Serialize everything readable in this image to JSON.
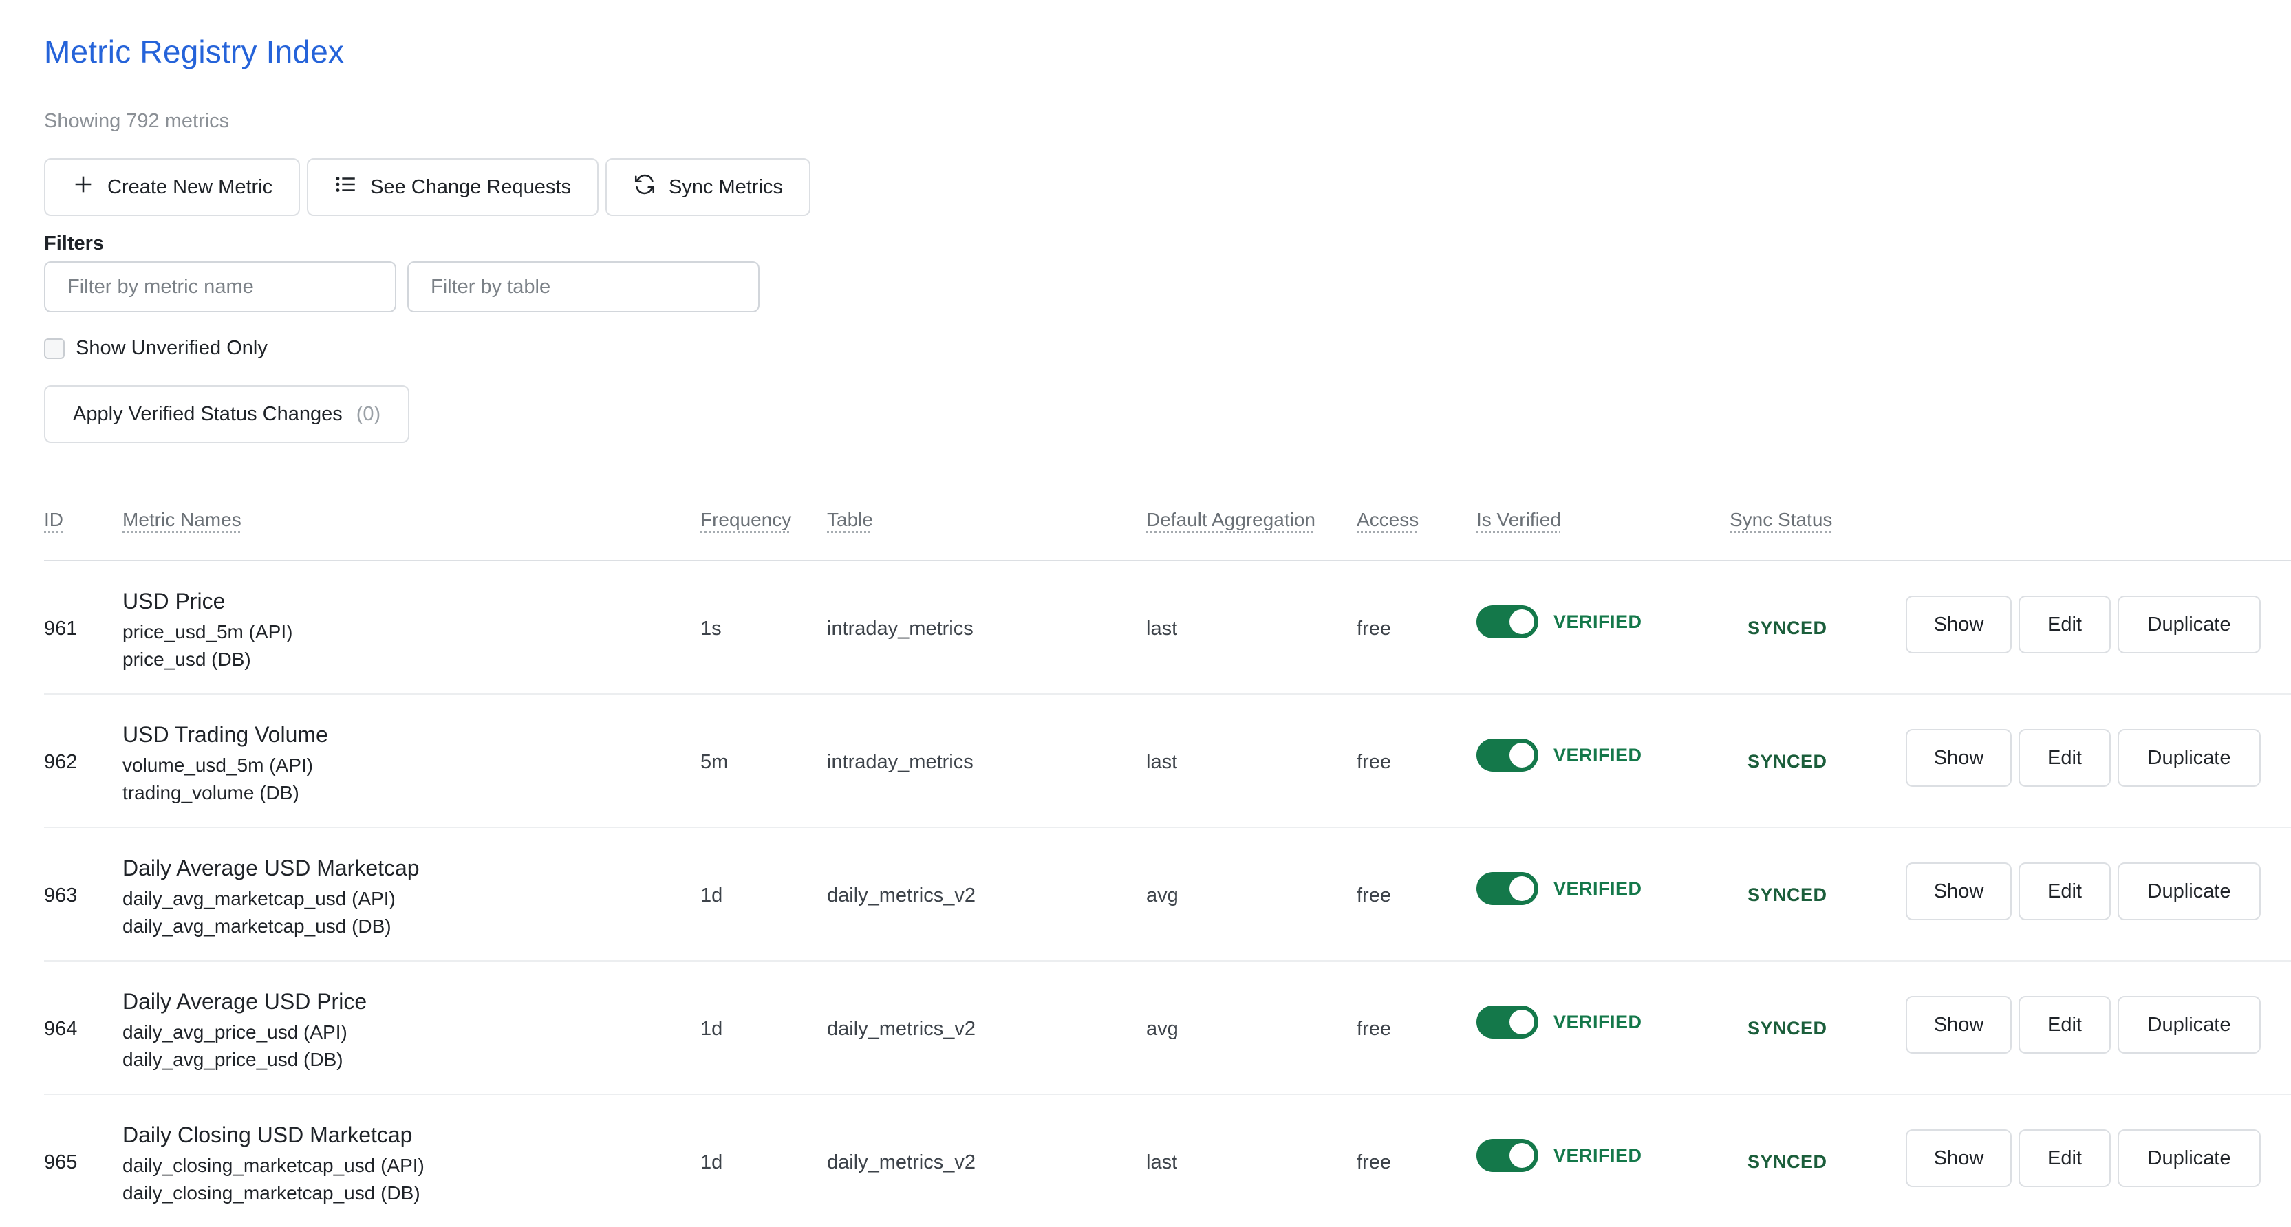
{
  "page": {
    "title": "Metric Registry Index",
    "count_text": "Showing 792 metrics"
  },
  "actions": {
    "create": "Create New Metric",
    "change_requests": "See Change Requests",
    "sync": "Sync Metrics"
  },
  "filters": {
    "label": "Filters",
    "metric_placeholder": "Filter by metric name",
    "table_placeholder": "Filter by table",
    "unverified_label": "Show Unverified Only",
    "unverified_checked": false,
    "apply_label": "Apply Verified Status Changes",
    "apply_count": "(0)"
  },
  "table": {
    "headers": {
      "id": "ID",
      "names": "Metric Names",
      "frequency": "Frequency",
      "table": "Table",
      "aggregation": "Default Aggregation",
      "access": "Access",
      "verified": "Is Verified",
      "sync": "Sync Status"
    },
    "rows": [
      {
        "id": "961",
        "name": "USD Price",
        "api": "price_usd_5m (API)",
        "db": "price_usd (DB)",
        "frequency": "1s",
        "table": "intraday_metrics",
        "aggregation": "last",
        "access": "free",
        "verified": "VERIFIED",
        "sync": "SYNCED"
      },
      {
        "id": "962",
        "name": "USD Trading Volume",
        "api": "volume_usd_5m (API)",
        "db": "trading_volume (DB)",
        "frequency": "5m",
        "table": "intraday_metrics",
        "aggregation": "last",
        "access": "free",
        "verified": "VERIFIED",
        "sync": "SYNCED"
      },
      {
        "id": "963",
        "name": "Daily Average USD Marketcap",
        "api": "daily_avg_marketcap_usd (API)",
        "db": "daily_avg_marketcap_usd (DB)",
        "frequency": "1d",
        "table": "daily_metrics_v2",
        "aggregation": "avg",
        "access": "free",
        "verified": "VERIFIED",
        "sync": "SYNCED"
      },
      {
        "id": "964",
        "name": "Daily Average USD Price",
        "api": "daily_avg_price_usd (API)",
        "db": "daily_avg_price_usd (DB)",
        "frequency": "1d",
        "table": "daily_metrics_v2",
        "aggregation": "avg",
        "access": "free",
        "verified": "VERIFIED",
        "sync": "SYNCED"
      },
      {
        "id": "965",
        "name": "Daily Closing USD Marketcap",
        "api": "daily_closing_marketcap_usd (API)",
        "db": "daily_closing_marketcap_usd (DB)",
        "frequency": "1d",
        "table": "daily_metrics_v2",
        "aggregation": "last",
        "access": "free",
        "verified": "VERIFIED",
        "sync": "SYNCED"
      }
    ],
    "row_actions": {
      "show": "Show",
      "edit": "Edit",
      "duplicate": "Duplicate"
    }
  },
  "colors": {
    "title": "#2563d9",
    "toggle_on": "#14784a",
    "synced": "#1b5e3b"
  },
  "icons": {
    "create": "plus-icon",
    "change_requests": "list-icon",
    "sync": "refresh-icon"
  }
}
